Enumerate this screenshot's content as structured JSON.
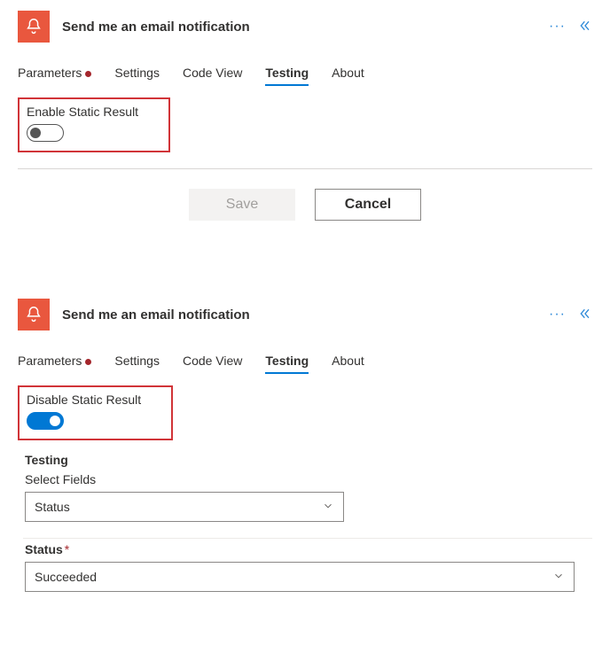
{
  "panel1": {
    "title": "Send me an email notification",
    "tabs": [
      {
        "label": "Parameters",
        "hasIndicator": true,
        "active": false
      },
      {
        "label": "Settings",
        "hasIndicator": false,
        "active": false
      },
      {
        "label": "Code View",
        "hasIndicator": false,
        "active": false
      },
      {
        "label": "Testing",
        "hasIndicator": false,
        "active": true
      },
      {
        "label": "About",
        "hasIndicator": false,
        "active": false
      }
    ],
    "toggle_label": "Enable Static Result",
    "toggle_state": "off",
    "buttons": {
      "save": "Save",
      "cancel": "Cancel"
    }
  },
  "panel2": {
    "title": "Send me an email notification",
    "tabs": [
      {
        "label": "Parameters",
        "hasIndicator": true,
        "active": false
      },
      {
        "label": "Settings",
        "hasIndicator": false,
        "active": false
      },
      {
        "label": "Code View",
        "hasIndicator": false,
        "active": false
      },
      {
        "label": "Testing",
        "hasIndicator": false,
        "active": true
      },
      {
        "label": "About",
        "hasIndicator": false,
        "active": false
      }
    ],
    "toggle_label": "Disable Static Result",
    "toggle_state": "on",
    "testing_heading": "Testing",
    "select_fields_label": "Select Fields",
    "select_fields_value": "Status",
    "status_label": "Status",
    "status_required": "*",
    "status_value": "Succeeded"
  }
}
